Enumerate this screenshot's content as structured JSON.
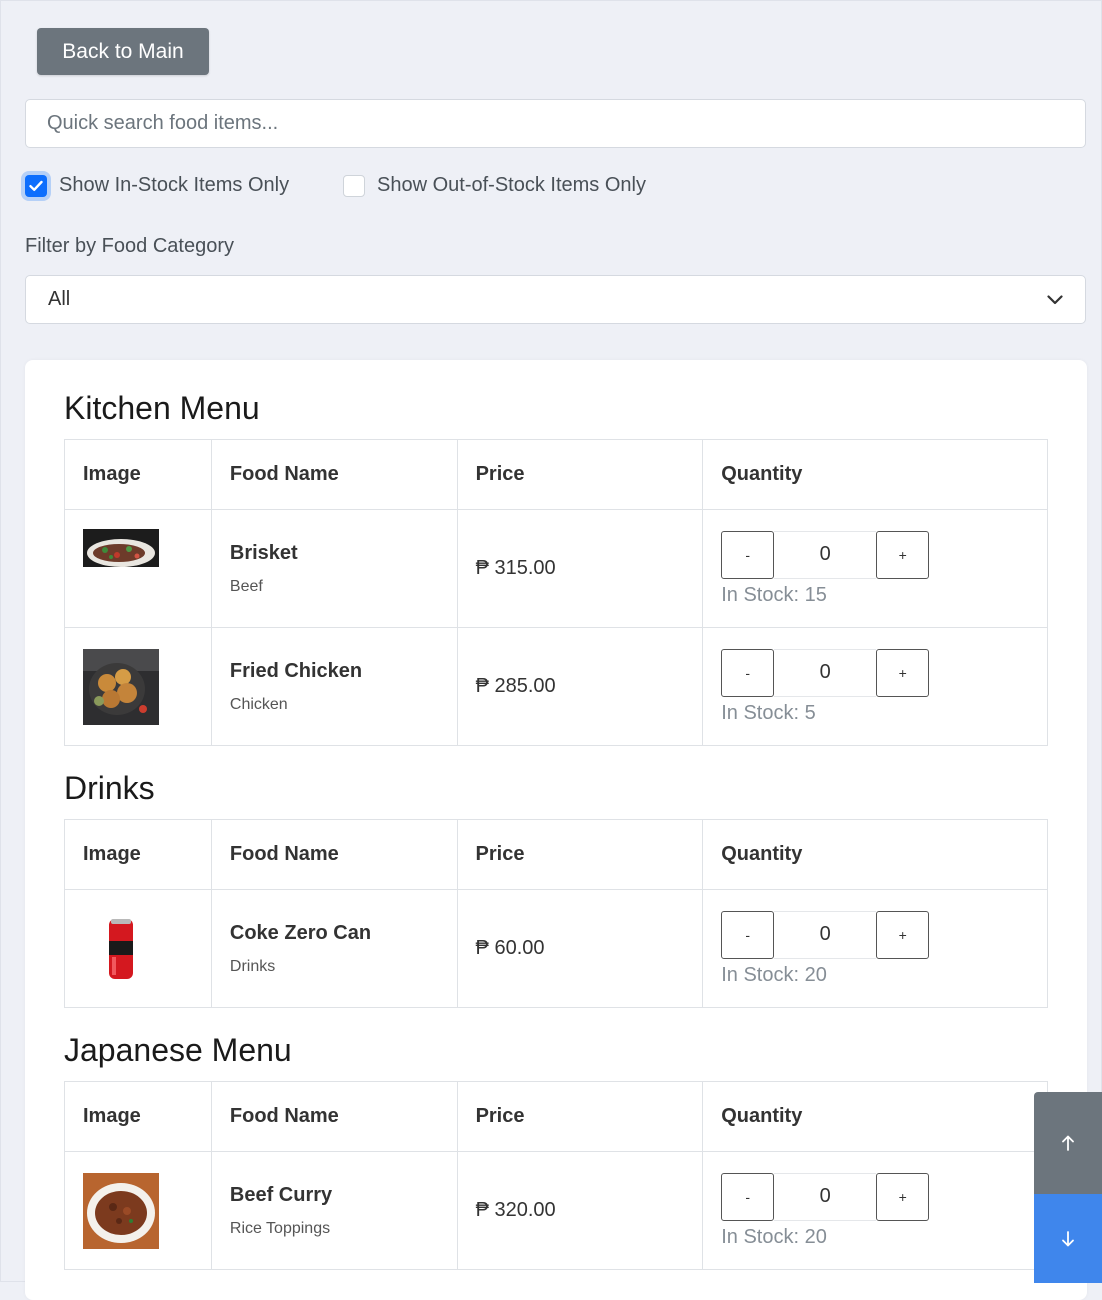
{
  "toolbar": {
    "back_label": "Back to Main"
  },
  "search": {
    "placeholder": "Quick search food items..."
  },
  "filters": {
    "in_stock_label": "Show In-Stock Items Only",
    "in_stock_checked": true,
    "out_of_stock_label": "Show Out-of-Stock Items Only",
    "out_of_stock_checked": false,
    "category_label": "Filter by Food Category",
    "category_selected": "All"
  },
  "columns": {
    "image": "Image",
    "name": "Food Name",
    "price": "Price",
    "quantity": "Quantity"
  },
  "sections": [
    {
      "title": "Kitchen Menu",
      "items": [
        {
          "name": "Brisket",
          "category": "Beef",
          "price": "₱ 315.00",
          "qty": "0",
          "stock": "In Stock: 15"
        },
        {
          "name": "Fried Chicken",
          "category": "Chicken",
          "price": "₱ 285.00",
          "qty": "0",
          "stock": "In Stock: 5"
        }
      ]
    },
    {
      "title": "Drinks",
      "items": [
        {
          "name": "Coke Zero Can",
          "category": "Drinks",
          "price": "₱ 60.00",
          "qty": "0",
          "stock": "In Stock: 20"
        }
      ]
    },
    {
      "title": "Japanese Menu",
      "items": [
        {
          "name": "Beef Curry",
          "category": "Rice Toppings",
          "price": "₱ 320.00",
          "qty": "0",
          "stock": "In Stock: 20"
        }
      ]
    }
  ],
  "qty_controls": {
    "minus": "-",
    "plus": "+"
  },
  "colors": {
    "accent": "#0d6efd",
    "secondary": "#6c757d",
    "scroll_down": "#3f86ec"
  },
  "icons": {
    "scroll_up": "arrow-up-icon",
    "scroll_down": "arrow-down-icon",
    "select": "chevron-down-icon"
  }
}
